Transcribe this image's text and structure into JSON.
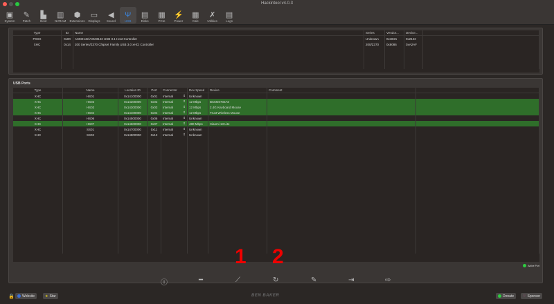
{
  "window": {
    "title": "Hackintool v4.0.3"
  },
  "toolbar": [
    {
      "label": "System",
      "icon": "▣"
    },
    {
      "label": "Patch",
      "icon": "✎"
    },
    {
      "label": "Boot",
      "icon": "▙"
    },
    {
      "label": "NVRAM",
      "icon": "▥"
    },
    {
      "label": "Extensions",
      "icon": "⬢"
    },
    {
      "label": "Displays",
      "icon": "▭"
    },
    {
      "label": "Sound",
      "icon": "◀"
    },
    {
      "label": "USB",
      "icon": "Ψ"
    },
    {
      "label": "Disks",
      "icon": "▤"
    },
    {
      "label": "PCIe",
      "icon": "▦"
    },
    {
      "label": "Power",
      "icon": "⚡"
    },
    {
      "label": "Calc",
      "icon": "▦"
    },
    {
      "label": "Utilities",
      "icon": "✗"
    },
    {
      "label": "Logs",
      "icon": "▤"
    }
  ],
  "controllers": {
    "headers": [
      "Type",
      "ID",
      "Name",
      "Series",
      "Vendor...",
      "Device..."
    ],
    "rows": [
      [
        "PXSX",
        "0x00",
        "ASM2142/ASM3142 USB 3.1 Host Controller",
        "Unknown",
        "0x1B21",
        "0x2142"
      ],
      [
        "XHC",
        "0x14",
        "200 Series/Z370 Chipset Family USB 3.0 xHCI Controller",
        "200/Z370",
        "0x8086",
        "0xA2AF"
      ]
    ]
  },
  "usb": {
    "label": "USB Ports",
    "headers": [
      "Type",
      "Name",
      "Location ID",
      "Port",
      "Connector",
      "Dev Speed",
      "Device",
      "Comment"
    ],
    "rows": [
      {
        "active": false,
        "cells": [
          "XHC",
          "HS01",
          "0x14100000",
          "0x01",
          "Internal",
          "Unknown",
          "",
          ""
        ]
      },
      {
        "active": true,
        "cells": [
          "XHC",
          "HS02",
          "0x14200000",
          "0x02",
          "Internal",
          "12 Mbps",
          "BCM20702A0",
          ""
        ]
      },
      {
        "active": true,
        "cells": [
          "XHC",
          "HS03",
          "0x14300000",
          "0x03",
          "Internal",
          "12 Mbps",
          "2.4G Keyboard Mouse",
          ""
        ]
      },
      {
        "active": true,
        "cells": [
          "XHC",
          "HS04",
          "0x14400000",
          "0x04",
          "Internal",
          "12 Mbps",
          "Trust Wireless Mouse",
          ""
        ]
      },
      {
        "active": false,
        "cells": [
          "XHC",
          "HS06",
          "0x14500000",
          "0x06",
          "Internal",
          "Unknown",
          "",
          ""
        ]
      },
      {
        "active": true,
        "cells": [
          "XHC",
          "HS07",
          "0x14600000",
          "0x07",
          "Internal",
          "480 Mbps",
          "Xiaomi 13 Lite",
          ""
        ]
      },
      {
        "active": false,
        "cells": [
          "XHC",
          "SS01",
          "0x14700000",
          "0x11",
          "Internal",
          "Unknown",
          "",
          ""
        ]
      },
      {
        "active": false,
        "cells": [
          "XHC",
          "SS02",
          "0x14800000",
          "0x12",
          "Internal",
          "Unknown",
          "",
          ""
        ]
      }
    ]
  },
  "legend": {
    "active_port": "Active Port",
    "color": "#2ecc40"
  },
  "annotations": [
    "1",
    "2"
  ],
  "footer": {
    "website": "Website",
    "star": "Star",
    "brand": "BEN BAKER",
    "donate": "Donate",
    "sponsor": "Sponsor"
  }
}
